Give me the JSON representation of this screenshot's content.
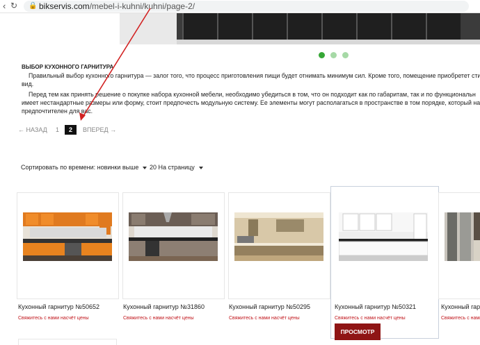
{
  "browser": {
    "url_domain": "bikservis.com",
    "url_path": "/mebel-i-kuhni/kuhni/page-2/"
  },
  "article": {
    "heading": "ВЫБОР КУХОННОГО ГАРНИТУРА",
    "lines": [
      "Правильный выбор кухонного гарнитура — залог того, что процесс приготовления пищи будет отнимать минимум сил. Кроме того, помещение приобретет стиль",
      "вид.",
      "Перед тем как принять решение о покупке набора кухонной мебели, необходимо убедиться в том, что он подходит как по габаритам, так и по функциональн",
      "имеет нестандартные размеры или форму, стоит предпочесть модульную систему. Ее элементы могут располагаться в пространстве в том порядке, который на",
      "предпочтителен для вас."
    ]
  },
  "pagination": {
    "prev": "← НАЗАД",
    "page1": "1",
    "page2": "2",
    "next": "ВПЕРЕД →"
  },
  "sort": {
    "order": "Сортировать по времени: новинки выше",
    "per_page": "20 На страницу"
  },
  "products": [
    {
      "name": "Кухонный гарнитур №50652",
      "price": "Свяжитесь с нами насчёт цены"
    },
    {
      "name": "Кухонный гарнитур №31860",
      "price": "Свяжитесь с нами насчёт цены"
    },
    {
      "name": "Кухонный гарнитур №50295",
      "price": "Свяжитесь с нами насчёт цены"
    },
    {
      "name": "Кухонный гарнитур №50321",
      "price": "Свяжитесь с нами насчёт цены"
    },
    {
      "name": "Кухонный гарнитур №",
      "price": "Свяжитесь с нами"
    }
  ],
  "view_button": "ПРОСМОТР",
  "colors": {
    "accent_red": "#8f1515",
    "price_red": "#c0141a",
    "annotation_arrow": "#d22222",
    "slider_active": "#36a736"
  }
}
